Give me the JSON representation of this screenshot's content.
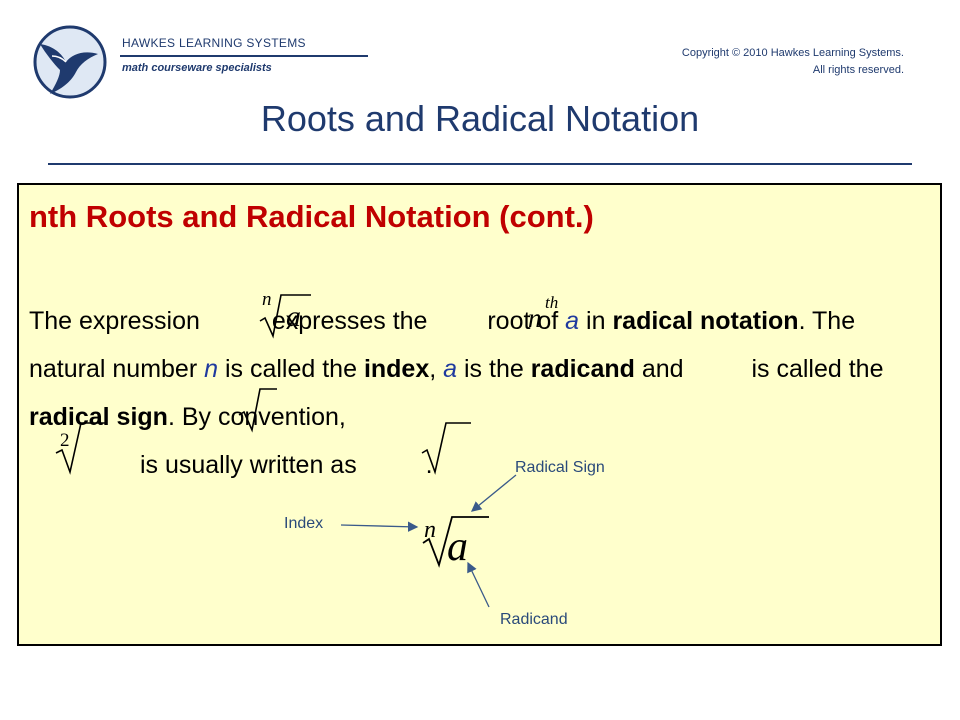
{
  "header": {
    "brand_name": "HAWKES LEARNING SYSTEMS",
    "tagline": "math courseware specialists",
    "copyright_line1": "Copyright © 2010 Hawkes Learning Systems.",
    "copyright_line2": "All rights reserved."
  },
  "page_title": "Roots and Radical Notation",
  "content": {
    "heading": "nth Roots and Radical Notation (cont.)",
    "paragraph": {
      "t1": "The expression ",
      "t2": " expresses the ",
      "t3": " root of ",
      "var_a": "a",
      "t4": " in ",
      "bold_radical_notation": "radical notation",
      "t5": ". The natural number ",
      "var_n": "n",
      "t6": " is called the ",
      "bold_index": "index",
      "t7": ", ",
      "t8": " is the ",
      "bold_radicand": "radicand",
      "t9": " and ",
      "t10": " is called the ",
      "bold_radical_sign": "radical sign",
      "t11": ". By convention, ",
      "t12": " is usually written as ",
      "t13": "."
    },
    "math": {
      "index_n": "n",
      "radicand_a": "a",
      "th": "th",
      "index_two": "2"
    },
    "diagram": {
      "label_radical_sign": "Radical Sign",
      "label_index": "Index",
      "label_radicand": "Radicand"
    }
  },
  "colors": {
    "navy": "#1f3a6e",
    "heading_red": "#c00000",
    "box_fill": "#ffffcc",
    "label_blue": "#2a4a7a"
  }
}
